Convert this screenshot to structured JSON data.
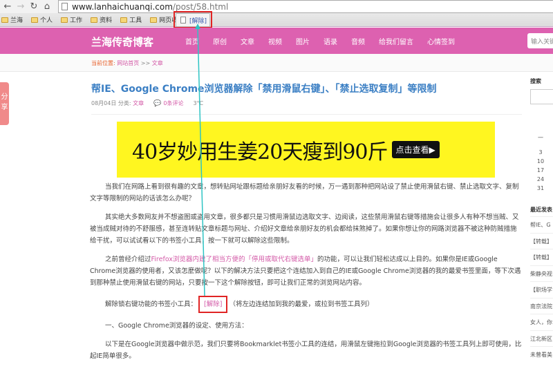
{
  "browser": {
    "url_host": "www.lanhaichuanqi.com",
    "url_path": "/post/58.html",
    "nav_icons": [
      "back-icon",
      "forward-icon",
      "reload-icon",
      "home-icon"
    ],
    "bookmarks": [
      "兰海",
      "个人",
      "工作",
      "资料",
      "工具",
      "网页收藏"
    ],
    "bookmarklet": "[解除]"
  },
  "header": {
    "site_title": "兰海传奇博客",
    "nav": [
      "首页",
      "原创",
      "文章",
      "视频",
      "图片",
      "语录",
      "音频",
      "给我们留言",
      "心情签到"
    ],
    "search_placeholder": "输入关键"
  },
  "breadcrumb": {
    "label": "当前位置:",
    "home": "网站首页",
    "sep": ">>",
    "current": "文章"
  },
  "share": {
    "label": "分享"
  },
  "article": {
    "title": "帮IE、Google Chrome浏览器解除「禁用滑鼠右键」、「禁止选取复制」等限制",
    "date": "08月04日",
    "category_label": "分类:",
    "category": "文章",
    "comments": "0条评论",
    "temperature": "3°C",
    "ad": {
      "text": "40岁妙用生姜20天瘦到90斤",
      "button": "点击查看▶"
    },
    "p1": "当我们在网路上看到很有趣的文章，想转贴网址跟标题给亲朋好友看的时候，万一遇到那种把网站设了禁止使用滑鼠右键、禁止选取文字、复制文字等限制的网站的话该怎么办呢？",
    "p2": "其实绝大多数网友并不想盗图或盗用文章，很多都只是习惯用滑鼠边选取文字、边阅读，这些禁用滑鼠右键等措施会让很多人有种不想当贼、又被当成贼对待的不舒服感，甚至连转贴文章标题与网址、介绍好文章给亲朋好友的机会都给抹煞掉了。如果你想让你的网路浏览器不被这种防贼措施给干扰，可以试试看以下的书签小工具，按一下就可以解除这些限制。",
    "p3_before": "之前曾经介绍过",
    "p3_link": "Firefox浏览器内建了相当方便的「停用或取代右键选单」",
    "p3_after": "的功能，可以让我们轻松达成以上目的。如果你是IE或Google Chrome浏览器的使用者，又该怎麼做呢？以下的解决方法只要把这个连结加入到自己的IE或Google Chrome浏览器的我的最爱书签里面，等下次遇到那种禁止使用滑鼠右键的网站，只要按一下这个解除按钮，即可让我们正常的浏览网站内容。",
    "p4_label": "解除锁右键功能的书签小工具：",
    "p4_link": "[解除]",
    "p4_after": "（将左边连结加到我的最爱，或拉到书签工具列）",
    "p5": "一、Google Chrome浏览器的设定、使用方法：",
    "p6": "以下是在Google浏览器中做示范，我们只要将Bookmarklet书签小工具的连结，用滑鼠左键拖拉到Google浏览器的书签工具列上即可使用，比起IE简单很多。"
  },
  "sidebar": {
    "search_title": "搜索",
    "calendar_header": "一",
    "calendar_days": [
      "3",
      "10",
      "17",
      "24",
      "31"
    ],
    "recent_title": "最近发表",
    "recent": [
      "帮IE、G",
      "【转载】",
      "【转载】",
      "柴静央视",
      "【职场学",
      "南京法院",
      "女人，你",
      "江北新区",
      "未曾看美"
    ]
  },
  "annotation": {
    "color": "#2ec4c4",
    "box_color": "#e02424"
  }
}
